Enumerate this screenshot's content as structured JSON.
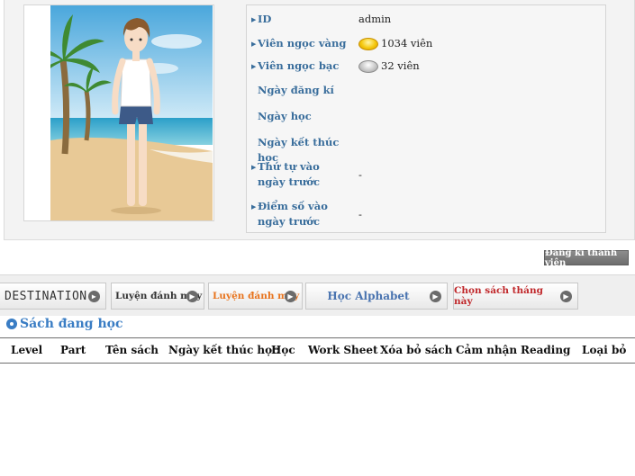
{
  "profile": {
    "rows": [
      {
        "label": "ID",
        "value": "admin"
      },
      {
        "label": "Viên ngọc vàng",
        "icon": "gold-gem-icon",
        "value": "1034 viên"
      },
      {
        "label": "Viên ngọc bạc",
        "icon": "silver-gem-icon",
        "value": "32 viên"
      },
      {
        "label": "Ngày đăng kí",
        "value": ""
      },
      {
        "label": "Ngày học",
        "value": ""
      },
      {
        "label": "Ngày kết thúc học",
        "value": ""
      },
      {
        "label": "Thứ tự vào ngày trước",
        "value": "-"
      },
      {
        "label": "Điểm số vào ngày trước",
        "value": "-"
      }
    ],
    "register_label": "Đăng kí thành viên"
  },
  "tabs": [
    {
      "label": "DESTINATION",
      "color": "#333333"
    },
    {
      "label": "Luyện đánh máy",
      "color": "#333333"
    },
    {
      "label": "Luyện đánh máy",
      "color": "#e8731c"
    },
    {
      "label": "Học Alphabet",
      "color": "#4a74b0"
    },
    {
      "label": "Chọn sách tháng này",
      "color": "#c0282b"
    }
  ],
  "section": {
    "title": "Sách đang học"
  },
  "table": {
    "columns": [
      "Level",
      "Part",
      "Tên sách",
      "Ngày kết thúc học",
      "Học",
      "Work Sheet",
      "Xóa bỏ sách",
      "Cảm nhận",
      "Reading",
      "Loại bỏ"
    ]
  }
}
